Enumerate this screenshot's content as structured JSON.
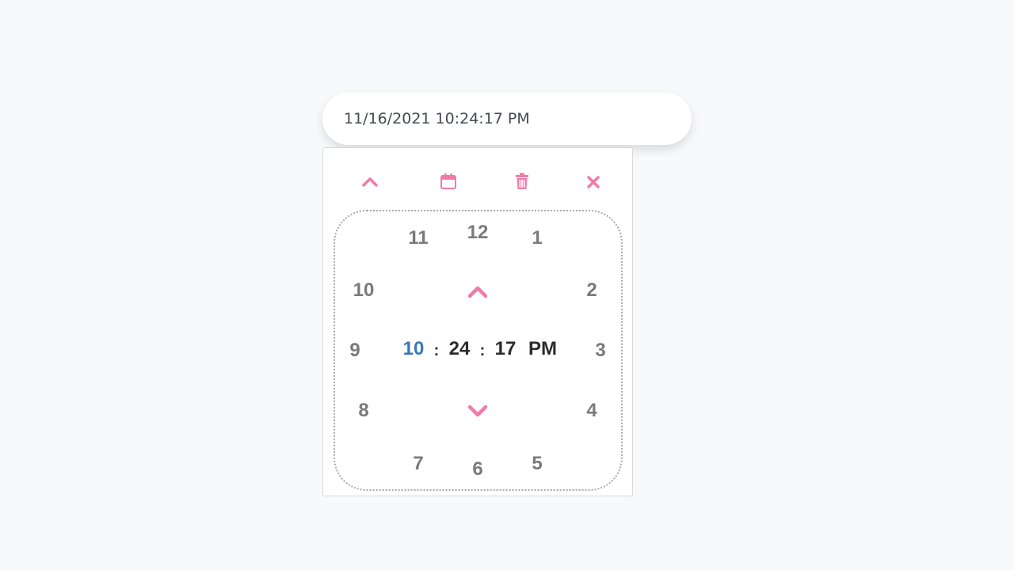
{
  "input": {
    "value": "11/16/2021 10:24:17 PM"
  },
  "colors": {
    "accent": "#f07ba8",
    "active_part": "#3a78b5",
    "numbers": "#7a7a7a",
    "time_text": "#2b2b2b"
  },
  "toolbar": {
    "icons": [
      "chevron-up-icon",
      "calendar-icon",
      "trash-icon",
      "close-icon"
    ]
  },
  "clock": {
    "hours": [
      "12",
      "1",
      "2",
      "3",
      "4",
      "5",
      "6",
      "7",
      "8",
      "9",
      "10",
      "11"
    ]
  },
  "time": {
    "hour": "10",
    "sep1": ":",
    "minute": "24",
    "sep2": ":",
    "second": "17",
    "period": "PM"
  }
}
